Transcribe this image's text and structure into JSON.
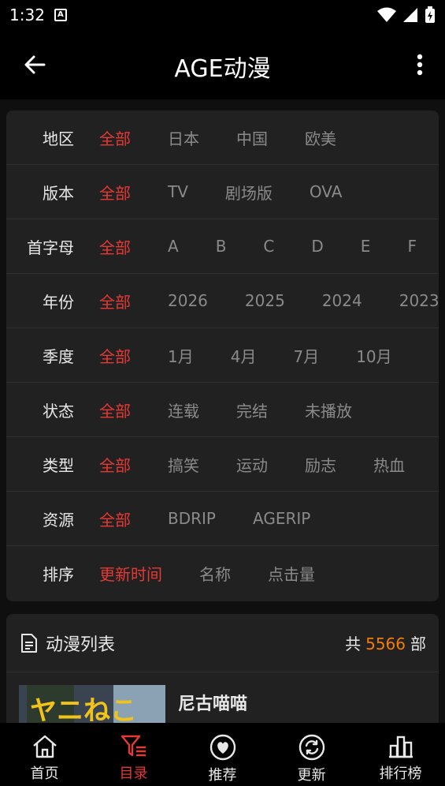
{
  "status_bar": {
    "time": "1:32",
    "notif_letter": "A"
  },
  "app_bar": {
    "title": "AGE动漫"
  },
  "filters": [
    {
      "label": "地区",
      "options": [
        "全部",
        "日本",
        "中国",
        "欧美"
      ],
      "active": 0
    },
    {
      "label": "版本",
      "options": [
        "全部",
        "TV",
        "剧场版",
        "OVA"
      ],
      "active": 0
    },
    {
      "label": "首字母",
      "options": [
        "全部",
        "A",
        "B",
        "C",
        "D",
        "E",
        "F"
      ],
      "active": 0
    },
    {
      "label": "年份",
      "options": [
        "全部",
        "2026",
        "2025",
        "2024",
        "2023"
      ],
      "active": 0
    },
    {
      "label": "季度",
      "options": [
        "全部",
        "1月",
        "4月",
        "7月",
        "10月"
      ],
      "active": 0
    },
    {
      "label": "状态",
      "options": [
        "全部",
        "连载",
        "完结",
        "未播放"
      ],
      "active": 0
    },
    {
      "label": "类型",
      "options": [
        "全部",
        "搞笑",
        "运动",
        "励志",
        "热血"
      ],
      "active": 0
    },
    {
      "label": "资源",
      "options": [
        "全部",
        "BDRIP",
        "AGERIP"
      ],
      "active": 0
    },
    {
      "label": "排序",
      "options": [
        "更新时间",
        "名称",
        "点击量"
      ],
      "active": 0
    }
  ],
  "list": {
    "title": "动漫列表",
    "count_prefix": "共",
    "count": "5566",
    "count_suffix": "部",
    "items": [
      {
        "name": "尼古喵喵",
        "cover_text": "ヤニねこ"
      }
    ]
  },
  "bottom_nav": [
    {
      "label": "首页",
      "icon": "home-icon"
    },
    {
      "label": "目录",
      "icon": "filter-icon",
      "active": true
    },
    {
      "label": "推荐",
      "icon": "heart-icon"
    },
    {
      "label": "更新",
      "icon": "refresh-icon"
    },
    {
      "label": "排行榜",
      "icon": "ranking-icon"
    }
  ],
  "colors": {
    "accent": "#e53935",
    "count": "#f57c00",
    "card": "#212121",
    "bg": "#0f0f0f"
  }
}
